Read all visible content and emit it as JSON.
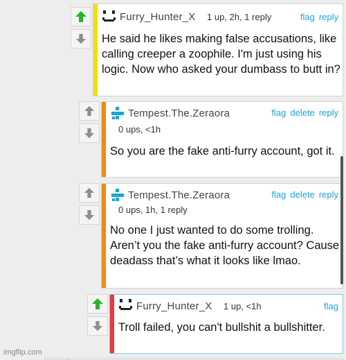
{
  "comments": [
    {
      "username": "Furry_Hunter_X",
      "meta": "1 up, 2h, 1 reply",
      "actions": [
        "flag",
        "reply"
      ],
      "text": "He said he likes making false accusations, like calling creeper a zoophile. I'm just using his logic. Now who asked your dumbass to butt in?",
      "stripe_color": "#f2e000",
      "upvote_active": true
    },
    {
      "username": "Tempest.The.Zeraora",
      "meta": "0 ups, <1h",
      "actions": [
        "flag",
        "delete",
        "reply"
      ],
      "text": "So you are the fake anti-furry account, got it.",
      "stripe_color": "#f08a10",
      "upvote_active": false
    },
    {
      "username": "Tempest.The.Zeraora",
      "meta": "0 ups, 1h, 1 reply",
      "actions": [
        "flag",
        "delete",
        "reply"
      ],
      "text": "No one I just wanted to do some trolling. Aren’t you the fake anti-furry account? Cause deadass that’s what it looks like lmao.",
      "stripe_color": "#f08a10",
      "upvote_active": false
    },
    {
      "username": "Furry_Hunter_X",
      "meta": "1 up, <1h",
      "actions": [
        "flag"
      ],
      "text": "Troll failed, you can't bullshit a bullshitter.",
      "stripe_color": "#e83a3a",
      "upvote_active": true
    }
  ],
  "watermark": "imgflip.com",
  "colors": {
    "link": "#1aa6d6",
    "upvote_active": "#2bb32b",
    "arrow_inactive": "#8e8e8e",
    "avatar_plus": "#1aa6d6"
  },
  "icons": {
    "upvote": "up-arrow-icon",
    "downvote": "down-arrow-icon",
    "avatar_face": "smiley-avatar-icon",
    "avatar_plus": "plus-avatar-icon"
  }
}
